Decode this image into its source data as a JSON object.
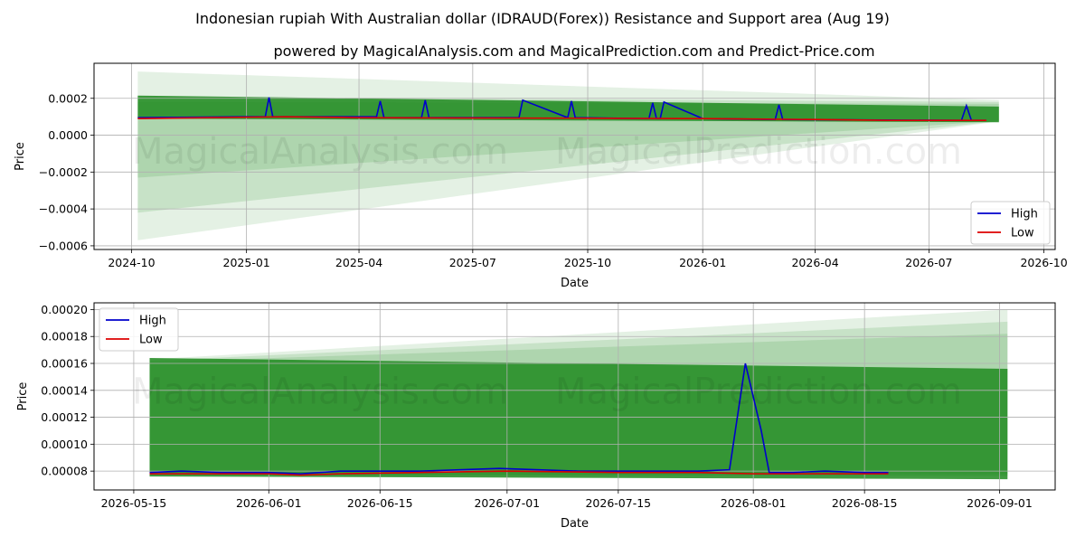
{
  "title": "Indonesian rupiah With Australian dollar (IDRAUD(Forex)) Resistance and Support area (Aug 19)",
  "subtitle": "powered by MagicalAnalysis.com and MagicalPrediction.com and Predict-Price.com",
  "watermark": [
    "MagicalAnalysis.com",
    "MagicalPrediction.com"
  ],
  "colors": {
    "high": "#0000cc",
    "low": "#dd0000",
    "band": "#228b22",
    "grid": "#b0b0b0"
  },
  "chart_data": [
    {
      "type": "line",
      "xlabel": "Date",
      "ylabel": "Price",
      "x_ticks": [
        "2024-10",
        "2025-01",
        "2025-04",
        "2025-07",
        "2025-10",
        "2026-01",
        "2026-04",
        "2026-07",
        "2026-10"
      ],
      "y_ticks": [
        "0.0002",
        "0.0000",
        "−0.0002",
        "−0.0004",
        "−0.0006"
      ],
      "xlim": [
        "2024-09-01",
        "2026-10-10"
      ],
      "ylim": [
        -0.00062,
        0.00039
      ],
      "grid": true,
      "legend": {
        "position": "lower-right",
        "entries": [
          "High",
          "Low"
        ]
      },
      "series": [
        {
          "name": "High",
          "color": "#0000cc",
          "x": [
            "2024-10-06",
            "2025-01-01",
            "2025-01-16",
            "2025-01-19",
            "2025-01-22",
            "2025-04-01",
            "2025-04-15",
            "2025-04-18",
            "2025-04-21",
            "2025-05-15",
            "2025-05-21",
            "2025-05-24",
            "2025-05-27",
            "2025-08-04",
            "2025-08-07",
            "2025-08-10",
            "2025-09-15",
            "2025-09-18",
            "2025-09-21",
            "2025-11-15",
            "2025-11-19",
            "2025-11-22",
            "2025-11-25",
            "2025-11-28",
            "2025-12-01",
            "2026-01-01",
            "2026-02-28",
            "2026-03-03",
            "2026-03-06",
            "2026-07-27",
            "2026-07-31",
            "2026-08-04",
            "2026-08-16"
          ],
          "y": [
            9.5e-05,
            0.0001,
            0.0001,
            0.000205,
            0.0001,
            0.0001,
            0.0001,
            0.000185,
            9.5e-05,
            9.5e-05,
            9.5e-05,
            0.00019,
            9.5e-05,
            9.5e-05,
            9.5e-05,
            0.00019,
            9.5e-05,
            0.000185,
            9.5e-05,
            9e-05,
            9e-05,
            0.000175,
            9e-05,
            9e-05,
            0.00018,
            9e-05,
            8.5e-05,
            0.000165,
            8.5e-05,
            8e-05,
            0.00016,
            8e-05,
            8e-05
          ]
        },
        {
          "name": "Low",
          "color": "#dd0000",
          "x": [
            "2024-10-06",
            "2024-12-01",
            "2025-02-01",
            "2025-04-01",
            "2025-07-01",
            "2025-10-01",
            "2026-01-01",
            "2026-04-01",
            "2026-06-01",
            "2026-08-16"
          ],
          "y": [
            9e-05,
            9.5e-05,
            0.0001,
            9.5e-05,
            9.3e-05,
            9.2e-05,
            9e-05,
            8.5e-05,
            8e-05,
            8e-05
          ]
        }
      ],
      "bands": [
        {
          "x": [
            "2024-10-06",
            "2026-08-26"
          ],
          "upper": [
            0.000215,
            0.000155
          ],
          "lower": [
            9e-05,
            7e-05
          ],
          "opacity": 0.85
        },
        {
          "x": [
            "2024-10-06",
            "2026-08-26"
          ],
          "upper": [
            0.000345,
            0.00019
          ],
          "lower": [
            -0.00057,
            7.5e-05
          ],
          "opacity": 0.12
        },
        {
          "x": [
            "2024-10-06",
            "2026-08-26"
          ],
          "upper": [
            0.00021,
            0.00018
          ],
          "lower": [
            -0.00042,
            7.6e-05
          ],
          "opacity": 0.15
        },
        {
          "x": [
            "2024-10-06",
            "2026-08-26"
          ],
          "upper": [
            0.00018,
            0.00017
          ],
          "lower": [
            -0.00023,
            7.8e-05
          ],
          "opacity": 0.15
        }
      ]
    },
    {
      "type": "line",
      "xlabel": "Date",
      "ylabel": "Price",
      "x_ticks": [
        "2026-05-15",
        "2026-06-01",
        "2026-06-15",
        "2026-07-01",
        "2026-07-15",
        "2026-08-01",
        "2026-08-15",
        "2026-09-01"
      ],
      "y_ticks": [
        "0.00020",
        "0.00018",
        "0.00016",
        "0.00014",
        "0.00012",
        "0.00010",
        "0.00008"
      ],
      "xlim": [
        "2026-05-10",
        "2026-09-08"
      ],
      "ylim": [
        6.6e-05,
        0.000205
      ],
      "grid": true,
      "legend": {
        "position": "top-left",
        "entries": [
          "High",
          "Low"
        ]
      },
      "series": [
        {
          "name": "High",
          "color": "#0000cc",
          "x": [
            "2026-05-17",
            "2026-05-21",
            "2026-05-26",
            "2026-06-01",
            "2026-06-05",
            "2026-06-10",
            "2026-06-15",
            "2026-06-20",
            "2026-06-25",
            "2026-06-30",
            "2026-07-05",
            "2026-07-10",
            "2026-07-15",
            "2026-07-20",
            "2026-07-25",
            "2026-07-29",
            "2026-07-31",
            "2026-08-02",
            "2026-08-03",
            "2026-08-06",
            "2026-08-10",
            "2026-08-15",
            "2026-08-18"
          ],
          "y": [
            7.9e-05,
            8e-05,
            7.9e-05,
            7.9e-05,
            7.8e-05,
            8e-05,
            8e-05,
            8e-05,
            8.1e-05,
            8.2e-05,
            8.1e-05,
            8e-05,
            8e-05,
            8e-05,
            8e-05,
            8.1e-05,
            0.00016,
            0.00011,
            7.9e-05,
            7.9e-05,
            8e-05,
            7.9e-05,
            7.9e-05
          ]
        },
        {
          "name": "Low",
          "color": "#dd0000",
          "x": [
            "2026-05-17",
            "2026-05-25",
            "2026-06-01",
            "2026-06-05",
            "2026-06-10",
            "2026-06-20",
            "2026-07-01",
            "2026-07-15",
            "2026-07-25",
            "2026-08-01",
            "2026-08-10",
            "2026-08-18"
          ],
          "y": [
            7.8e-05,
            7.8e-05,
            7.8e-05,
            7.7e-05,
            7.8e-05,
            7.9e-05,
            8e-05,
            7.9e-05,
            7.9e-05,
            7.8e-05,
            7.8e-05,
            7.8e-05
          ]
        }
      ],
      "bands": [
        {
          "x": [
            "2026-05-17",
            "2026-09-02"
          ],
          "upper": [
            0.000164,
            0.000156
          ],
          "lower": [
            7.6e-05,
            7.4e-05
          ],
          "opacity": 0.85
        },
        {
          "x": [
            "2026-05-17",
            "2026-09-02"
          ],
          "upper": [
            0.000163,
            0.0002
          ],
          "lower": [
            7.7e-05,
            7.6e-05
          ],
          "opacity": 0.12
        },
        {
          "x": [
            "2026-05-17",
            "2026-09-02"
          ],
          "upper": [
            0.000162,
            0.000191
          ],
          "lower": [
            7.7e-05,
            7.7e-05
          ],
          "opacity": 0.15
        },
        {
          "x": [
            "2026-05-17",
            "2026-09-02"
          ],
          "upper": [
            0.000161,
            0.000182
          ],
          "lower": [
            7.7e-05,
            7.8e-05
          ],
          "opacity": 0.15
        }
      ]
    }
  ]
}
